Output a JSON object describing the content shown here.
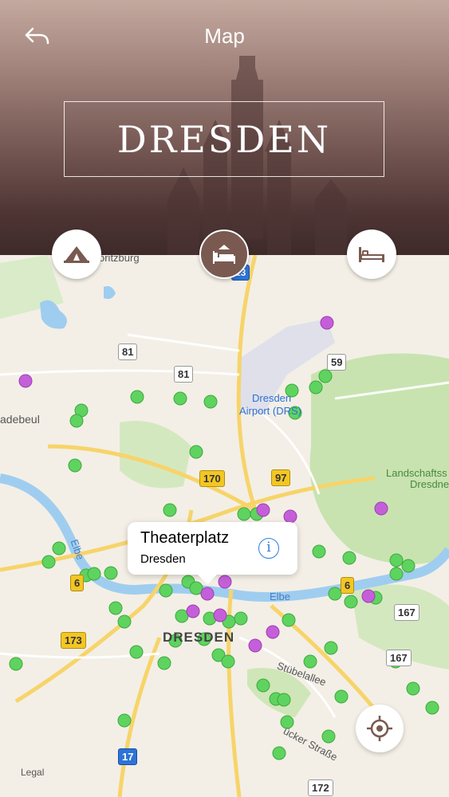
{
  "nav": {
    "back_icon": "back-arrow-icon",
    "title": "Map"
  },
  "city": {
    "name": "DRESDEN"
  },
  "categories": [
    {
      "icon": "tent-icon",
      "selected": false
    },
    {
      "icon": "hotel-bed-icon",
      "selected": true
    },
    {
      "icon": "bed-icon",
      "selected": false
    }
  ],
  "map": {
    "places": [
      "oritzburg",
      "adebeul",
      "Dresden",
      "Airport (DRS)",
      "Landschaftss",
      "Dresdne",
      "DRESDEN",
      "Elbe",
      "Elbe",
      "Stübelallee",
      "ücker Straße"
    ],
    "road_labels": {
      "r81a": "81",
      "r81b": "81",
      "r59": "59",
      "r170": "170",
      "r97": "97",
      "r6a": "6",
      "r6b": "6",
      "r173": "173",
      "r167a": "167",
      "r167b": "167",
      "r17": "17",
      "r172": "172",
      "r13": "13"
    },
    "pin_colors": {
      "green": "#5fd35f",
      "purple": "#c55fd9"
    }
  },
  "callout": {
    "title": "Theaterplatz",
    "subtitle": "Dresden",
    "info_icon": "info-icon",
    "info_glyph": "i"
  },
  "controls": {
    "locate_icon": "locate-icon",
    "legal": "Legal"
  }
}
